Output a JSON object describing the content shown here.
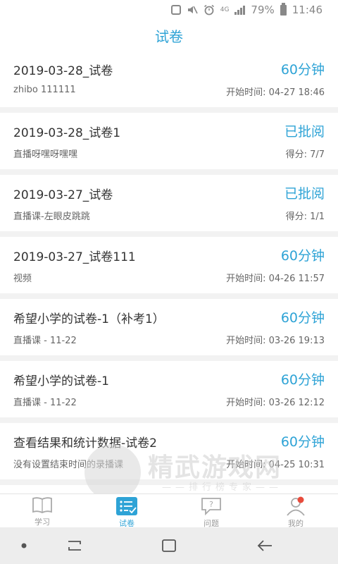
{
  "status_bar": {
    "network": "4G",
    "battery": "79%",
    "time": "11:46",
    "icons": [
      "android-box-icon",
      "mute-icon",
      "alarm-icon",
      "signal-icon",
      "battery-icon"
    ]
  },
  "header": {
    "title": "试卷"
  },
  "exams": [
    {
      "title": "2019-03-28_试卷",
      "status": "60分钟",
      "subtitle": "zhibo 111111",
      "meta": "开始时间: 04-27 18:46"
    },
    {
      "title": "2019-03-28_试卷1",
      "status": "已批阅",
      "subtitle": "直播呀嘿呀嘿嘿",
      "meta": "得分: 7/7"
    },
    {
      "title": "2019-03-27_试卷",
      "status": "已批阅",
      "subtitle": "直播课-左眼皮跳跳",
      "meta": "得分: 1/1"
    },
    {
      "title": "2019-03-27_试卷111",
      "status": "60分钟",
      "subtitle": "视频",
      "meta": "开始时间: 04-26 11:57"
    },
    {
      "title": "希望小学的试卷-1（补考1）",
      "status": "60分钟",
      "subtitle": "直播课 - 11-22",
      "meta": "开始时间: 03-26 19:13"
    },
    {
      "title": "希望小学的试卷-1",
      "status": "60分钟",
      "subtitle": "直播课 - 11-22",
      "meta": "开始时间: 03-26 12:12"
    },
    {
      "title": "查看结果和统计数据-试卷2",
      "status": "60分钟",
      "subtitle": "没有设置结束时间的录播课",
      "meta": "开始时间: 04-25 10:31"
    }
  ],
  "watermark": {
    "text": "精武游戏网",
    "sub": "——排行榜专家——"
  },
  "tabs": [
    {
      "label": "学习",
      "icon": "book-icon",
      "active": false
    },
    {
      "label": "试卷",
      "icon": "exam-list-icon",
      "active": true
    },
    {
      "label": "问题",
      "icon": "question-bubble-icon",
      "active": false
    },
    {
      "label": "我的",
      "icon": "profile-icon",
      "active": false
    }
  ],
  "colors": {
    "accent": "#2ea3d6",
    "badge": "#e84b3c",
    "text": "#333333",
    "subtext": "#666666"
  }
}
